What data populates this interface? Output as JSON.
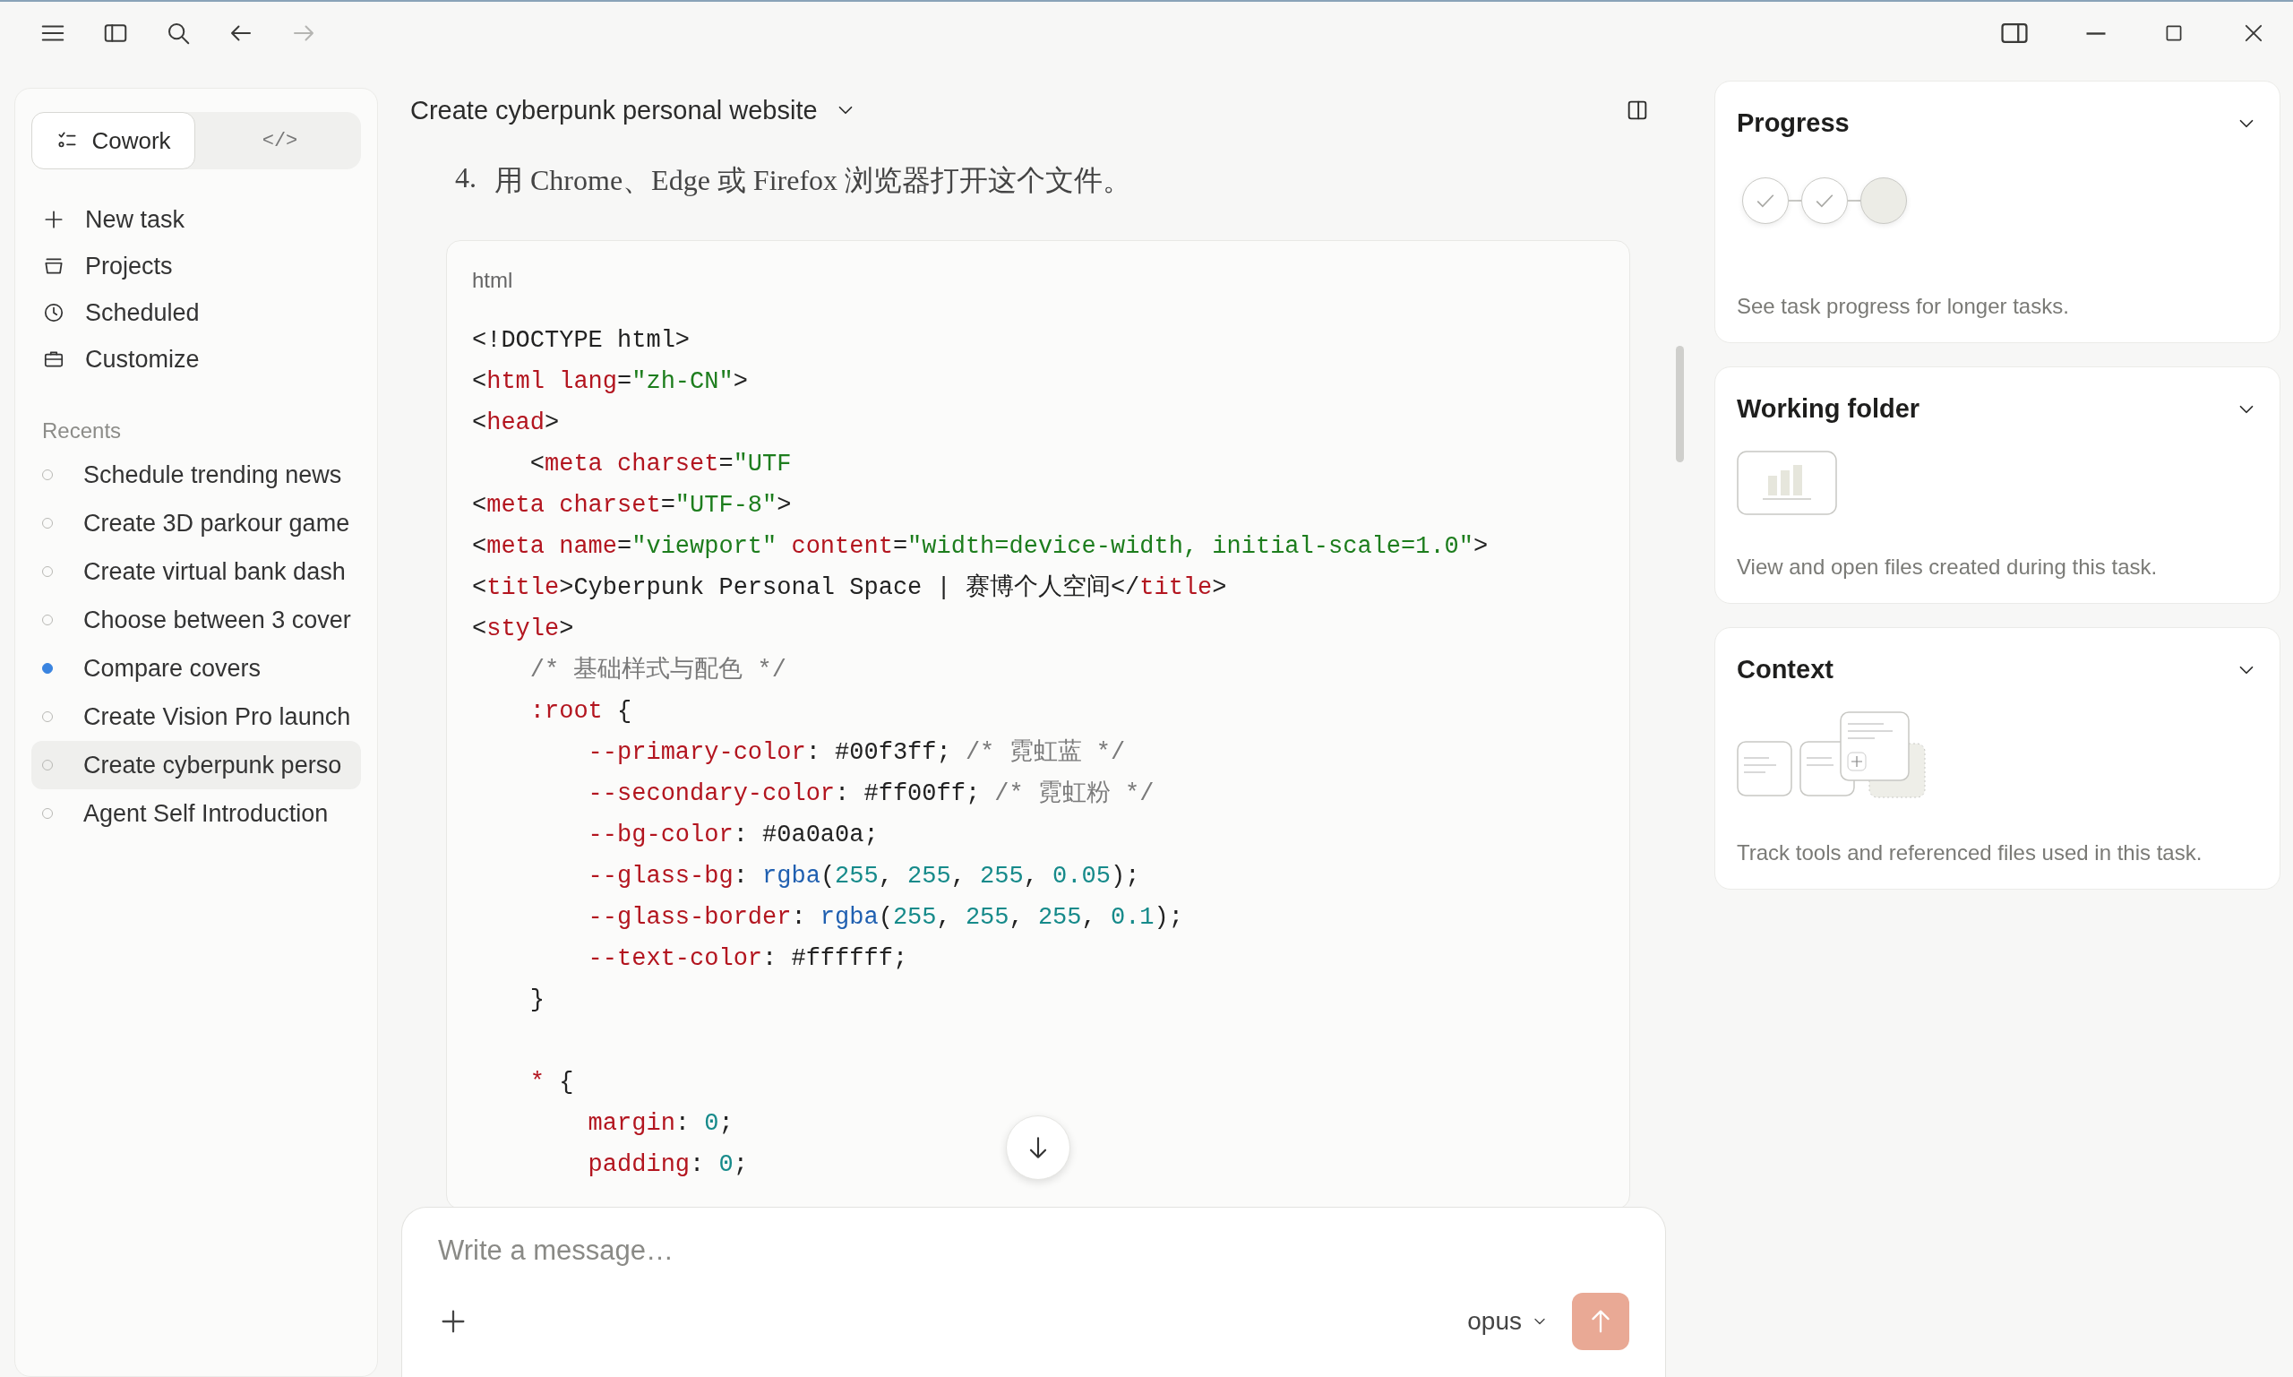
{
  "title_bar": {
    "nav_forward_disabled": true
  },
  "sidebar": {
    "mode_tabs": [
      {
        "label": "Cowork",
        "kind": "cowork",
        "selected": true
      },
      {
        "label": "</>",
        "kind": "code",
        "selected": false
      }
    ],
    "nav": [
      {
        "label": "New task",
        "kind": "plus"
      },
      {
        "label": "Projects",
        "kind": "tray"
      },
      {
        "label": "Scheduled",
        "kind": "clock"
      },
      {
        "label": "Customize",
        "kind": "briefcase"
      }
    ],
    "recents_label": "Recents",
    "recents": [
      {
        "label": "Schedule trending news",
        "running": false,
        "selected": false
      },
      {
        "label": "Create 3D parkour game",
        "running": false,
        "selected": false
      },
      {
        "label": "Create virtual bank dash",
        "running": false,
        "selected": false
      },
      {
        "label": "Choose between 3 cover",
        "running": false,
        "selected": false
      },
      {
        "label": "Compare covers",
        "running": true,
        "selected": false
      },
      {
        "label": "Create Vision Pro launch",
        "running": false,
        "selected": false
      },
      {
        "label": "Create cyberpunk perso",
        "running": false,
        "selected": true
      },
      {
        "label": "Agent Self Introduction",
        "running": false,
        "selected": false
      }
    ]
  },
  "conversation": {
    "title": "Create cyberpunk personal website",
    "list_item": {
      "number": "4.",
      "text": "用 Chrome、Edge 或 Firefox 浏览器打开这个文件。"
    },
    "code_block": {
      "language": "html",
      "lines": [
        [
          {
            "kind": "plain",
            "text": "<!DOCTYPE html>"
          }
        ],
        [
          {
            "kind": "plain",
            "text": "<"
          },
          {
            "kind": "tag",
            "text": "html"
          },
          {
            "kind": "tag",
            "text": " lang"
          },
          {
            "kind": "plain",
            "text": "="
          },
          {
            "kind": "string",
            "text": "\"zh-CN\""
          },
          {
            "kind": "plain",
            "text": ">"
          }
        ],
        [
          {
            "kind": "plain",
            "text": "<"
          },
          {
            "kind": "tag",
            "text": "head"
          },
          {
            "kind": "plain",
            "text": ">"
          }
        ],
        [
          {
            "kind": "plain",
            "text": "    <"
          },
          {
            "kind": "tag",
            "text": "meta"
          },
          {
            "kind": "tag",
            "text": " charset"
          },
          {
            "kind": "plain",
            "text": "="
          },
          {
            "kind": "string",
            "text": "\"UTF"
          }
        ],
        [
          {
            "kind": "plain",
            "text": "<"
          },
          {
            "kind": "tag",
            "text": "meta"
          },
          {
            "kind": "tag",
            "text": " charset"
          },
          {
            "kind": "plain",
            "text": "="
          },
          {
            "kind": "string",
            "text": "\"UTF-8\""
          },
          {
            "kind": "plain",
            "text": ">"
          }
        ],
        [
          {
            "kind": "plain",
            "text": "<"
          },
          {
            "kind": "tag",
            "text": "meta"
          },
          {
            "kind": "tag",
            "text": " name"
          },
          {
            "kind": "plain",
            "text": "="
          },
          {
            "kind": "string",
            "text": "\"viewport\""
          },
          {
            "kind": "tag",
            "text": " content"
          },
          {
            "kind": "plain",
            "text": "="
          },
          {
            "kind": "string",
            "text": "\"width=device-width, initial-scale=1.0\""
          },
          {
            "kind": "plain",
            "text": ">"
          }
        ],
        [
          {
            "kind": "plain",
            "text": "<"
          },
          {
            "kind": "tag",
            "text": "title"
          },
          {
            "kind": "plain",
            "text": ">Cyberpunk Personal Space | 赛博个人空间</"
          },
          {
            "kind": "tag",
            "text": "title"
          },
          {
            "kind": "plain",
            "text": ">"
          }
        ],
        [
          {
            "kind": "plain",
            "text": "<"
          },
          {
            "kind": "tag",
            "text": "style"
          },
          {
            "kind": "plain",
            "text": ">"
          }
        ],
        [
          {
            "kind": "comment",
            "text": "    /* 基础样式与配色 */"
          }
        ],
        [
          {
            "kind": "tag",
            "text": "    :root"
          },
          {
            "kind": "plain",
            "text": " {"
          }
        ],
        [
          {
            "kind": "tag",
            "text": "        --primary-color"
          },
          {
            "kind": "plain",
            "text": ": #00f3ff;"
          },
          {
            "kind": "comment",
            "text": " /* 霓虹蓝 */"
          }
        ],
        [
          {
            "kind": "tag",
            "text": "        --secondary-color"
          },
          {
            "kind": "plain",
            "text": ": #ff00ff;"
          },
          {
            "kind": "comment",
            "text": " /* 霓虹粉 */"
          }
        ],
        [
          {
            "kind": "tag",
            "text": "        --bg-color"
          },
          {
            "kind": "plain",
            "text": ": #0a0a0a;"
          }
        ],
        [
          {
            "kind": "tag",
            "text": "        --glass-bg"
          },
          {
            "kind": "plain",
            "text": ":"
          },
          {
            "kind": "function",
            "text": " rgba"
          },
          {
            "kind": "plain",
            "text": "("
          },
          {
            "kind": "number",
            "text": "255"
          },
          {
            "kind": "plain",
            "text": ","
          },
          {
            "kind": "number",
            "text": " 255"
          },
          {
            "kind": "plain",
            "text": ","
          },
          {
            "kind": "number",
            "text": " 255"
          },
          {
            "kind": "plain",
            "text": ","
          },
          {
            "kind": "number",
            "text": " 0.05"
          },
          {
            "kind": "plain",
            "text": ");"
          }
        ],
        [
          {
            "kind": "tag",
            "text": "        --glass-border"
          },
          {
            "kind": "plain",
            "text": ":"
          },
          {
            "kind": "function",
            "text": " rgba"
          },
          {
            "kind": "plain",
            "text": "("
          },
          {
            "kind": "number",
            "text": "255"
          },
          {
            "kind": "plain",
            "text": ","
          },
          {
            "kind": "number",
            "text": " 255"
          },
          {
            "kind": "plain",
            "text": ","
          },
          {
            "kind": "number",
            "text": " 255"
          },
          {
            "kind": "plain",
            "text": ","
          },
          {
            "kind": "number",
            "text": " 0.1"
          },
          {
            "kind": "plain",
            "text": ");"
          }
        ],
        [
          {
            "kind": "tag",
            "text": "        --text-color"
          },
          {
            "kind": "plain",
            "text": ": #ffffff;"
          }
        ],
        [
          {
            "kind": "plain",
            "text": "    }"
          }
        ],
        [
          {
            "kind": "blank"
          }
        ],
        [
          {
            "kind": "tag",
            "text": "    *"
          },
          {
            "kind": "plain",
            "text": " {"
          }
        ],
        [
          {
            "kind": "tag",
            "text": "        margin"
          },
          {
            "kind": "plain",
            "text": ":"
          },
          {
            "kind": "number",
            "text": " 0"
          },
          {
            "kind": "plain",
            "text": ";"
          }
        ],
        [
          {
            "kind": "tag",
            "text": "        padding"
          },
          {
            "kind": "plain",
            "text": ":"
          },
          {
            "kind": "number",
            "text": " 0"
          },
          {
            "kind": "plain",
            "text": ";"
          }
        ]
      ]
    }
  },
  "composer": {
    "placeholder": "Write a message…",
    "model": "opus"
  },
  "panels": [
    {
      "title": "Progress",
      "kind": "progress",
      "steps": [
        {
          "done": true
        },
        {
          "done": true
        },
        {
          "done": false
        }
      ],
      "description": "See task progress for longer tasks."
    },
    {
      "title": "Working folder",
      "kind": "folder",
      "description": "View and open files created during this task."
    },
    {
      "title": "Context",
      "kind": "context",
      "description": "Track tools and referenced files used in this task."
    }
  ]
}
